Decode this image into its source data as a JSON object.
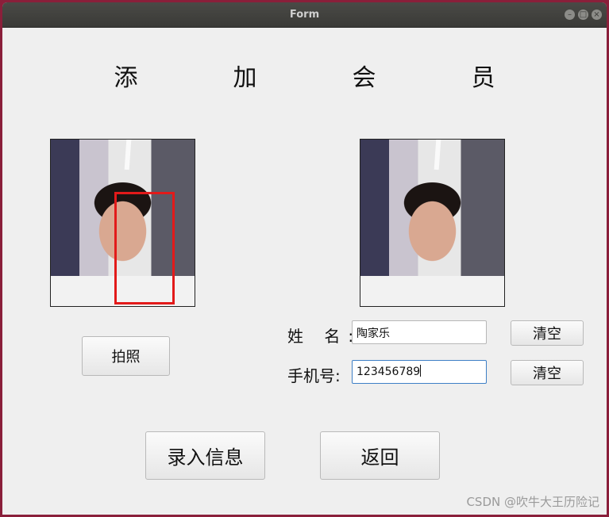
{
  "window": {
    "title": "Form",
    "controls": [
      "minimize-icon",
      "maximize-icon",
      "close-icon"
    ]
  },
  "heading": {
    "chars": [
      "添",
      "加",
      "会",
      "员"
    ]
  },
  "capture": {
    "photo_button": "拍照"
  },
  "form": {
    "name_label": "姓 名:",
    "name_value": "陶家乐",
    "phone_label": "手机号:",
    "phone_value": "123456789",
    "clear_label": "清空"
  },
  "actions": {
    "submit_label": "录入信息",
    "back_label": "返回"
  },
  "watermark": "CSDN @吹牛大王历险记",
  "colors": {
    "face_box": "#e21a1a",
    "focus_border": "#3e7fc6"
  }
}
